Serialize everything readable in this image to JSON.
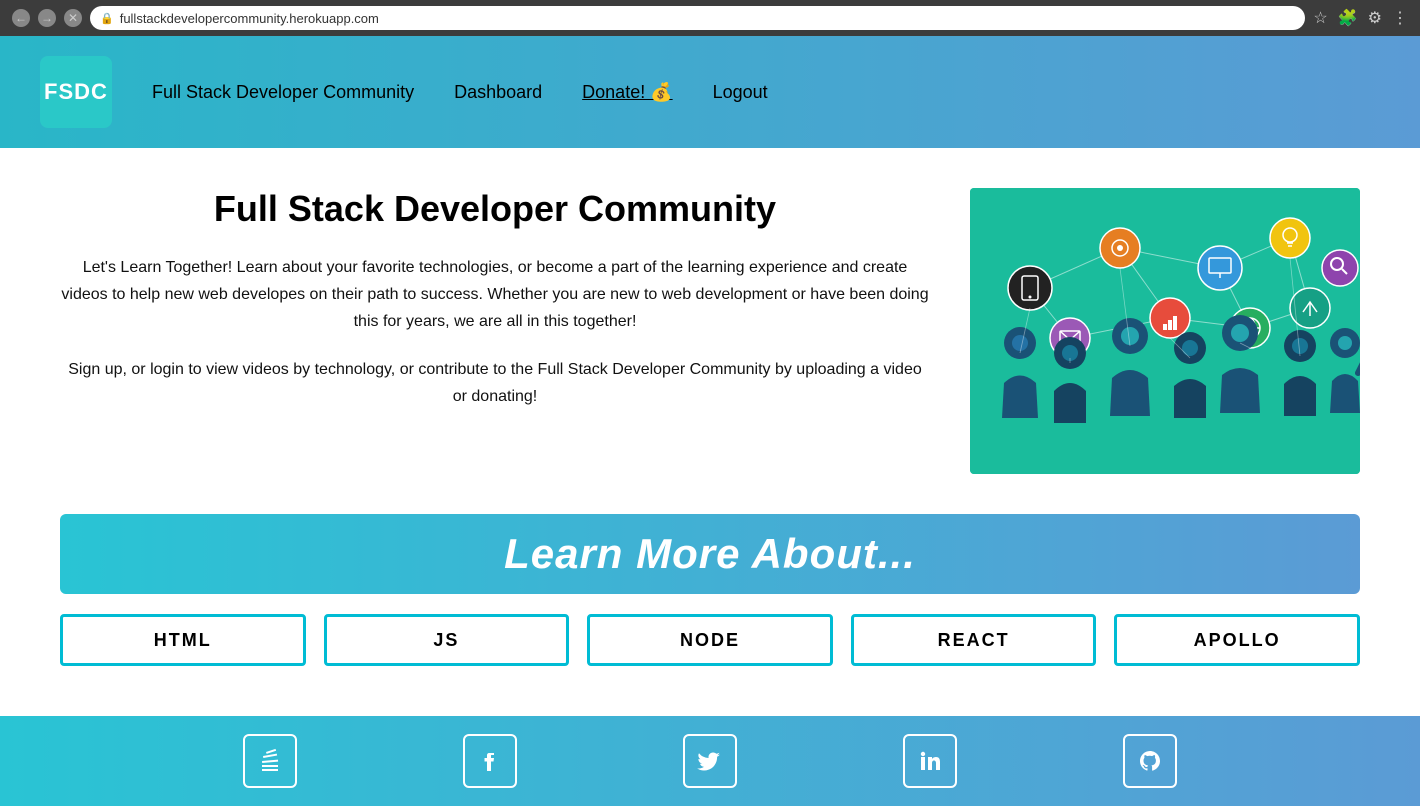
{
  "browser": {
    "url": "fullstackdevelopercommunity.herokuapp.com",
    "back_label": "←",
    "forward_label": "→",
    "close_label": "✕"
  },
  "navbar": {
    "logo_text": "FSDC",
    "site_title": "Full Stack Developer Community",
    "links": [
      {
        "label": "Dashboard",
        "id": "dashboard"
      },
      {
        "label": "Donate! 💰",
        "id": "donate"
      },
      {
        "label": "Logout",
        "id": "logout"
      }
    ]
  },
  "hero": {
    "title": "Full Stack Developer Community",
    "description1": "Let's Learn Together! Learn about your favorite technologies, or become a part of the learning experience and create videos to help new web developes on their path to success. Whether you are new to web development or have been doing this for years, we are all in this together!",
    "description2": "Sign up, or login to view videos by technology, or contribute to the Full Stack Developer Community by uploading a video or donating!"
  },
  "learn_more": {
    "banner_text": "Learn More About...",
    "buttons": [
      {
        "label": "HTML",
        "id": "html"
      },
      {
        "label": "JS",
        "id": "js"
      },
      {
        "label": "NODE",
        "id": "node"
      },
      {
        "label": "REACT",
        "id": "react"
      },
      {
        "label": "APOLLO",
        "id": "apollo"
      }
    ]
  },
  "footer": {
    "icons": [
      {
        "name": "stack-overflow-icon",
        "symbol": "⬆"
      },
      {
        "name": "facebook-icon",
        "symbol": "f"
      },
      {
        "name": "twitter-icon",
        "symbol": "🐦"
      },
      {
        "name": "linkedin-icon",
        "symbol": "in"
      },
      {
        "name": "github-icon",
        "symbol": "⚙"
      }
    ]
  },
  "colors": {
    "teal": "#2ac8c8",
    "blue_grad_start": "#29c4d4",
    "blue_grad_end": "#5b9bd5",
    "navbar_bg": "#5b9bd5",
    "button_border": "#00bcd4"
  }
}
